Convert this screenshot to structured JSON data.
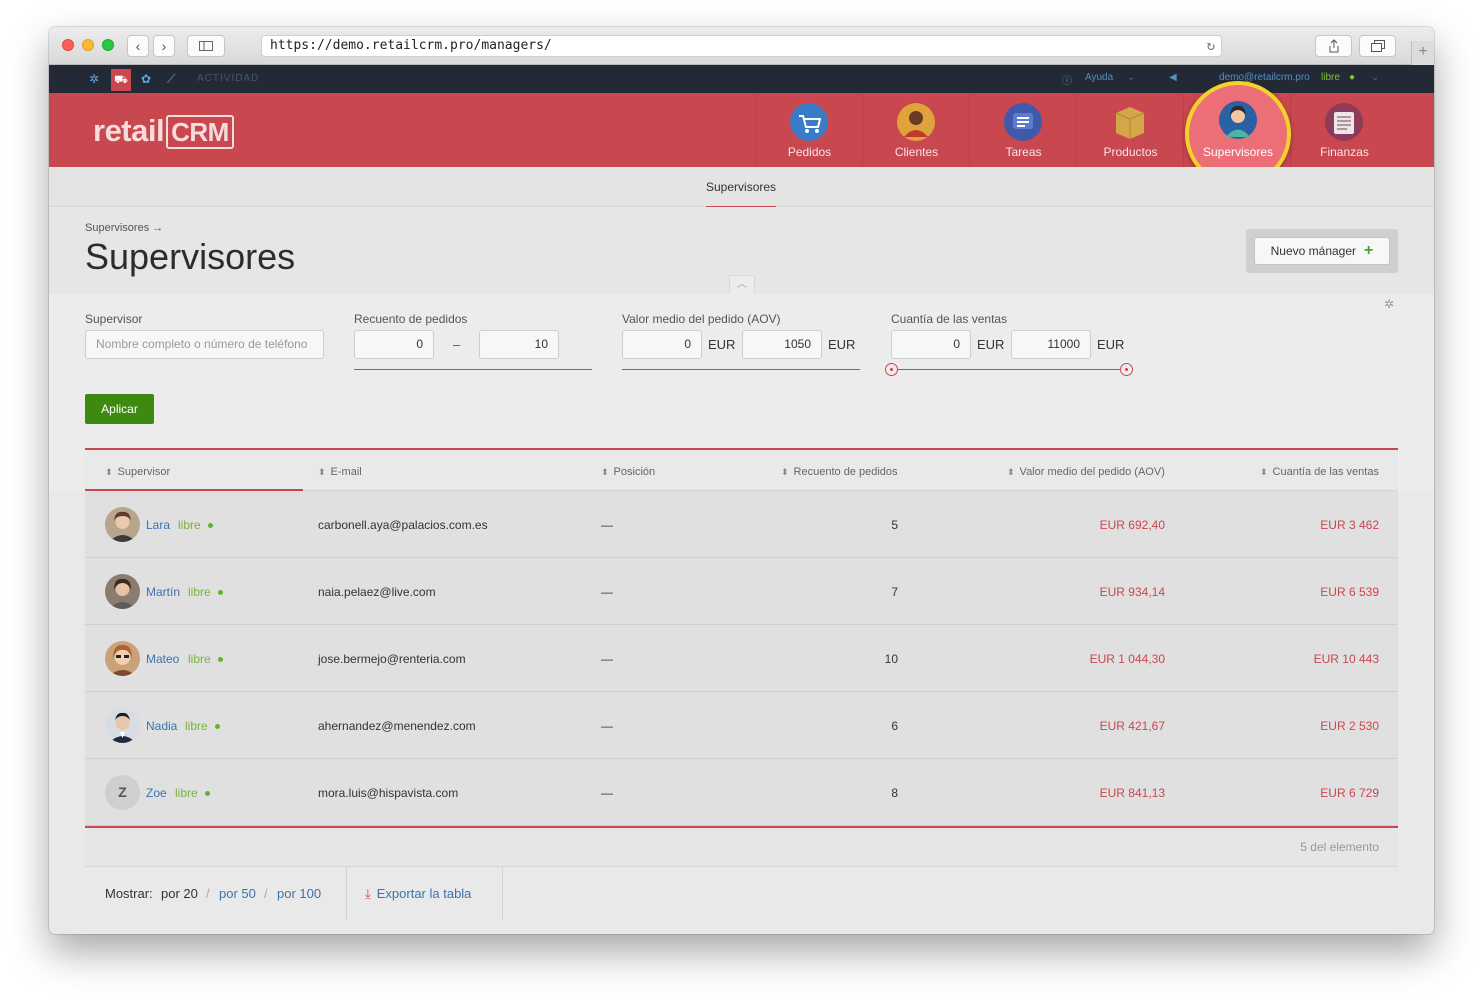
{
  "browser": {
    "url": "https://demo.retailcrm.pro/managers/",
    "back_icon": "chevron-left-icon",
    "forward_icon": "chevron-right-icon"
  },
  "topbar": {
    "activity": "ACTIVIDAD",
    "help": "Ayuda",
    "user": "demo@retailcrm.pro",
    "user_status": "libre"
  },
  "logo": {
    "retail": "retail",
    "crm": "CRM"
  },
  "nav": [
    {
      "label": "Pedidos",
      "icon": "cart-icon",
      "color": "#3a7bc8"
    },
    {
      "label": "Clientes",
      "icon": "client-icon",
      "color": "#e0a23a"
    },
    {
      "label": "Tareas",
      "icon": "tasks-icon",
      "color": "#3f5aa8"
    },
    {
      "label": "Productos",
      "icon": "box-icon",
      "color": "#d4a64a"
    },
    {
      "label": "Supervisores",
      "icon": "supervisor-icon",
      "color": "#2a60a4"
    },
    {
      "label": "Finanzas",
      "icon": "finance-icon",
      "color": "#8e3a5a"
    }
  ],
  "subnav": {
    "active": "Supervisores"
  },
  "page": {
    "breadcrumb": "Supervisores →",
    "title": "Supervisores",
    "new_button": "Nuevo mánager"
  },
  "filters": {
    "supervisor_label": "Supervisor",
    "supervisor_placeholder": "Nombre completo o número de teléfono",
    "orders_label": "Recuento de pedidos",
    "orders_from": "0",
    "orders_to": "10",
    "aov_label": "Valor medio del pedido (AOV)",
    "aov_from": "0",
    "aov_to": "1050",
    "sales_label": "Cuantía de las ventas",
    "sales_from": "0",
    "sales_to": "11000",
    "currency": "EUR",
    "apply": "Aplicar"
  },
  "table": {
    "headers": {
      "supervisor": "Supervisor",
      "email": "E-mail",
      "position": "Posición",
      "orders": "Recuento de pedidos",
      "aov": "Valor medio del pedido (AOV)",
      "sales": "Cuantía de las ventas"
    },
    "rows": [
      {
        "name": "Lara",
        "status": "libre",
        "email": "carbonell.aya@palacios.com.es",
        "position": "—",
        "orders": "5",
        "aov": "EUR 692,40",
        "sales": "EUR 3 462",
        "avatar": "photo"
      },
      {
        "name": "Martín",
        "status": "libre",
        "email": "naia.pelaez@live.com",
        "position": "—",
        "orders": "7",
        "aov": "EUR 934,14",
        "sales": "EUR 6 539",
        "avatar": "photo"
      },
      {
        "name": "Mateo",
        "status": "libre",
        "email": "jose.bermejo@renteria.com",
        "position": "—",
        "orders": "10",
        "aov": "EUR 1 044,30",
        "sales": "EUR 10 443",
        "avatar": "photo"
      },
      {
        "name": "Nadia",
        "status": "libre",
        "email": "ahernandez@menendez.com",
        "position": "—",
        "orders": "6",
        "aov": "EUR 421,67",
        "sales": "EUR 2 530",
        "avatar": "photo"
      },
      {
        "name": "Zoe",
        "status": "libre",
        "email": "mora.luis@hispavista.com",
        "position": "—",
        "orders": "8",
        "aov": "EUR 841,13",
        "sales": "EUR 6 729",
        "avatar": "Z"
      }
    ],
    "count_text": "5 del elemento"
  },
  "footer": {
    "show_label": "Mostrar:",
    "per_20": "por 20",
    "per_50": "por 50",
    "per_100": "por 100",
    "separator": "/",
    "export": "Exportar la tabla"
  },
  "colors": {
    "brand_red": "#c9474f",
    "highlight_ring": "#f4d12a",
    "apply_green": "#3e8a10",
    "link_blue": "#3d72b0"
  }
}
